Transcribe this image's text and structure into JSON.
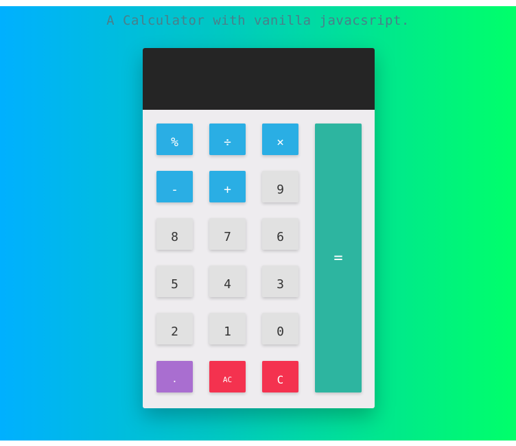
{
  "page": {
    "title": "A Calculator with vanilla javacsript."
  },
  "calculator": {
    "display_value": "",
    "keys": {
      "percent": "%",
      "divide": "÷",
      "multiply": "×",
      "minus": "-",
      "plus": "+",
      "nine": "9",
      "eight": "8",
      "seven": "7",
      "six": "6",
      "five": "5",
      "four": "4",
      "three": "3",
      "two": "2",
      "one": "1",
      "zero": "0",
      "dot": ".",
      "all_clear": "AC",
      "clear": "C",
      "equals": "="
    }
  },
  "colors": {
    "background_start": "#00b0ff",
    "background_end": "#00ff6a",
    "display": "#252525",
    "operator_key": "#2aaee4",
    "number_key": "#e1e1e1",
    "dot_key": "#a96ed0",
    "clear_key": "#f4324f",
    "equals_key": "#2db5a0"
  }
}
